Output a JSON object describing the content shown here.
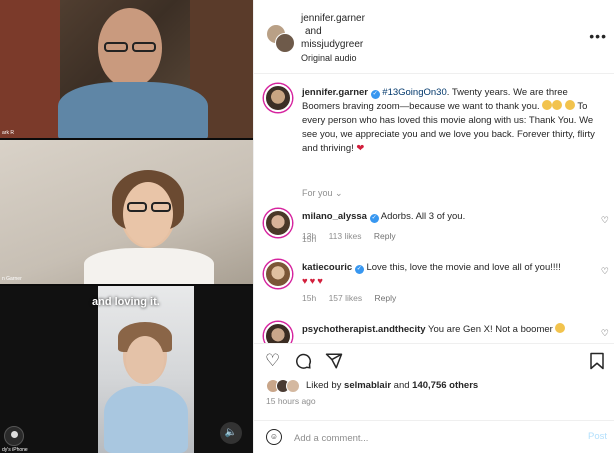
{
  "video": {
    "tile1_name": "ark R",
    "tile2_name": "n Garner",
    "caption": "and loving it.",
    "tile3_name": "dy's iPhone"
  },
  "header": {
    "user1": "jennifer.garner",
    "connector": "and",
    "user2": "missjudygreer",
    "audio": "Original audio",
    "more_icon": "more-horizontal-icon"
  },
  "post_caption": {
    "username": "jennifer.garner",
    "hashtag": "#13GoingOn30",
    "text1": ". Twenty years. We are three Boomers braving zoom—because we want to thank you.",
    "text2": "To every person who has loved this movie along with us: Thank You. We see you, we appreciate you and we love you back. Forever thirty, flirty and thriving!",
    "time": "15h"
  },
  "for_you": "For you",
  "comments": [
    {
      "username": "milano_alyssa",
      "text": "Adorbs. All 3 of you.",
      "time": "13h",
      "likes": "113 likes",
      "reply": "Reply"
    },
    {
      "username": "katiecouric",
      "text": "Love this, love the movie and love all of you!!!!",
      "hearts": "♥♥♥",
      "time": "15h",
      "likes": "157 likes",
      "reply": "Reply"
    },
    {
      "username": "psychotherapist.andthecity",
      "text": "You are Gen X! Not a boomer"
    }
  ],
  "likes": {
    "prefix": "Liked by",
    "user": "selmablair",
    "and": "and",
    "count": "140,756 others"
  },
  "post_time": "15 hours ago",
  "add_comment": {
    "placeholder": "Add a comment...",
    "post": "Post"
  },
  "colors": {
    "verified": "#3897f0",
    "link": "#00376b",
    "muted": "#8e8e8e",
    "post_disabled": "#b2dffc"
  }
}
